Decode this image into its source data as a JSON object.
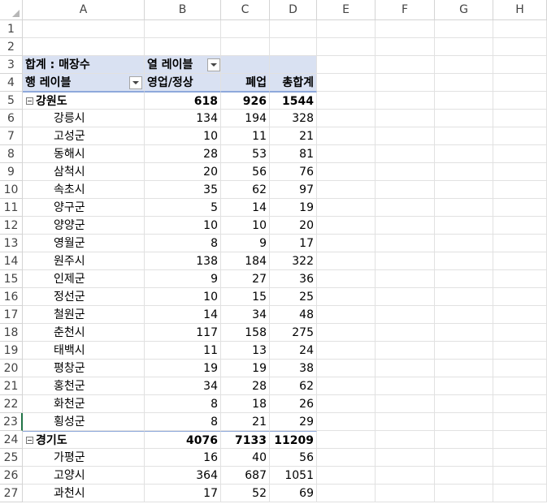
{
  "columns": [
    "A",
    "B",
    "C",
    "D",
    "E",
    "F",
    "G",
    "H"
  ],
  "rows": [
    "1",
    "2",
    "3",
    "4",
    "5",
    "6",
    "7",
    "8",
    "9",
    "10",
    "11",
    "12",
    "13",
    "14",
    "15",
    "16",
    "17",
    "18",
    "19",
    "20",
    "21",
    "22",
    "23",
    "24",
    "25",
    "26",
    "27"
  ],
  "pivot": {
    "sum_label": "합계 : 매장수",
    "col_labels": "열 레이블",
    "row_labels": "행 레이블",
    "headers": [
      "영업/정상",
      "폐업",
      "총합계"
    ]
  },
  "groups": [
    {
      "name": "강원도",
      "totals": [
        "618",
        "926",
        "1544"
      ],
      "items": [
        {
          "name": "강릉시",
          "v": [
            "134",
            "194",
            "328"
          ]
        },
        {
          "name": "고성군",
          "v": [
            "10",
            "11",
            "21"
          ]
        },
        {
          "name": "동해시",
          "v": [
            "28",
            "53",
            "81"
          ]
        },
        {
          "name": "삼척시",
          "v": [
            "20",
            "56",
            "76"
          ]
        },
        {
          "name": "속초시",
          "v": [
            "35",
            "62",
            "97"
          ]
        },
        {
          "name": "양구군",
          "v": [
            "5",
            "14",
            "19"
          ]
        },
        {
          "name": "양양군",
          "v": [
            "10",
            "10",
            "20"
          ]
        },
        {
          "name": "영월군",
          "v": [
            "8",
            "9",
            "17"
          ]
        },
        {
          "name": "원주시",
          "v": [
            "138",
            "184",
            "322"
          ]
        },
        {
          "name": "인제군",
          "v": [
            "9",
            "27",
            "36"
          ]
        },
        {
          "name": "정선군",
          "v": [
            "10",
            "15",
            "25"
          ]
        },
        {
          "name": "철원군",
          "v": [
            "14",
            "34",
            "48"
          ]
        },
        {
          "name": "춘천시",
          "v": [
            "117",
            "158",
            "275"
          ]
        },
        {
          "name": "태백시",
          "v": [
            "11",
            "13",
            "24"
          ]
        },
        {
          "name": "평창군",
          "v": [
            "19",
            "19",
            "38"
          ]
        },
        {
          "name": "홍천군",
          "v": [
            "34",
            "28",
            "62"
          ]
        },
        {
          "name": "화천군",
          "v": [
            "8",
            "18",
            "26"
          ]
        },
        {
          "name": "횡성군",
          "v": [
            "8",
            "21",
            "29"
          ]
        }
      ]
    },
    {
      "name": "경기도",
      "totals": [
        "4076",
        "7133",
        "11209"
      ],
      "items": [
        {
          "name": "가평군",
          "v": [
            "16",
            "40",
            "56"
          ]
        },
        {
          "name": "고양시",
          "v": [
            "364",
            "687",
            "1051"
          ]
        },
        {
          "name": "과천시",
          "v": [
            "17",
            "52",
            "69"
          ]
        }
      ]
    }
  ],
  "selected_row": "23",
  "colors": {
    "pivot_header_bg": "#d9e1f2",
    "pivot_border": "#8ea9db",
    "selection": "#217346"
  }
}
